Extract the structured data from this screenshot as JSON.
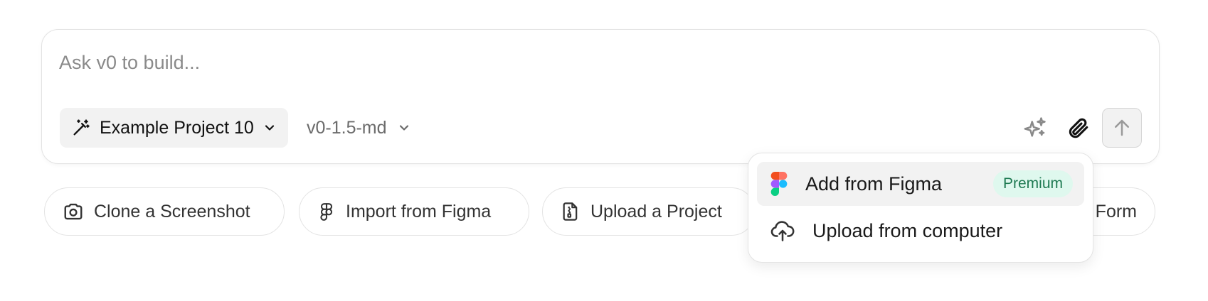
{
  "prompt": {
    "placeholder": "Ask v0 to build..."
  },
  "toolbar": {
    "project_label": "Example Project 10",
    "model_label": "v0-1.5-md"
  },
  "suggestions": [
    {
      "label": "Clone a Screenshot",
      "icon": "camera-icon"
    },
    {
      "label": "Import from Figma",
      "icon": "figma-icon"
    },
    {
      "label": "Upload a Project",
      "icon": "file-icon"
    },
    {
      "label": "Form",
      "icon": ""
    }
  ],
  "menu": {
    "items": [
      {
        "label": "Add from Figma",
        "icon": "figma-color-icon",
        "badge": "Premium"
      },
      {
        "label": "Upload from computer",
        "icon": "cloud-upload-icon"
      }
    ]
  },
  "colors": {
    "badge_bg": "#dff8ee",
    "badge_text": "#1e7a52"
  }
}
